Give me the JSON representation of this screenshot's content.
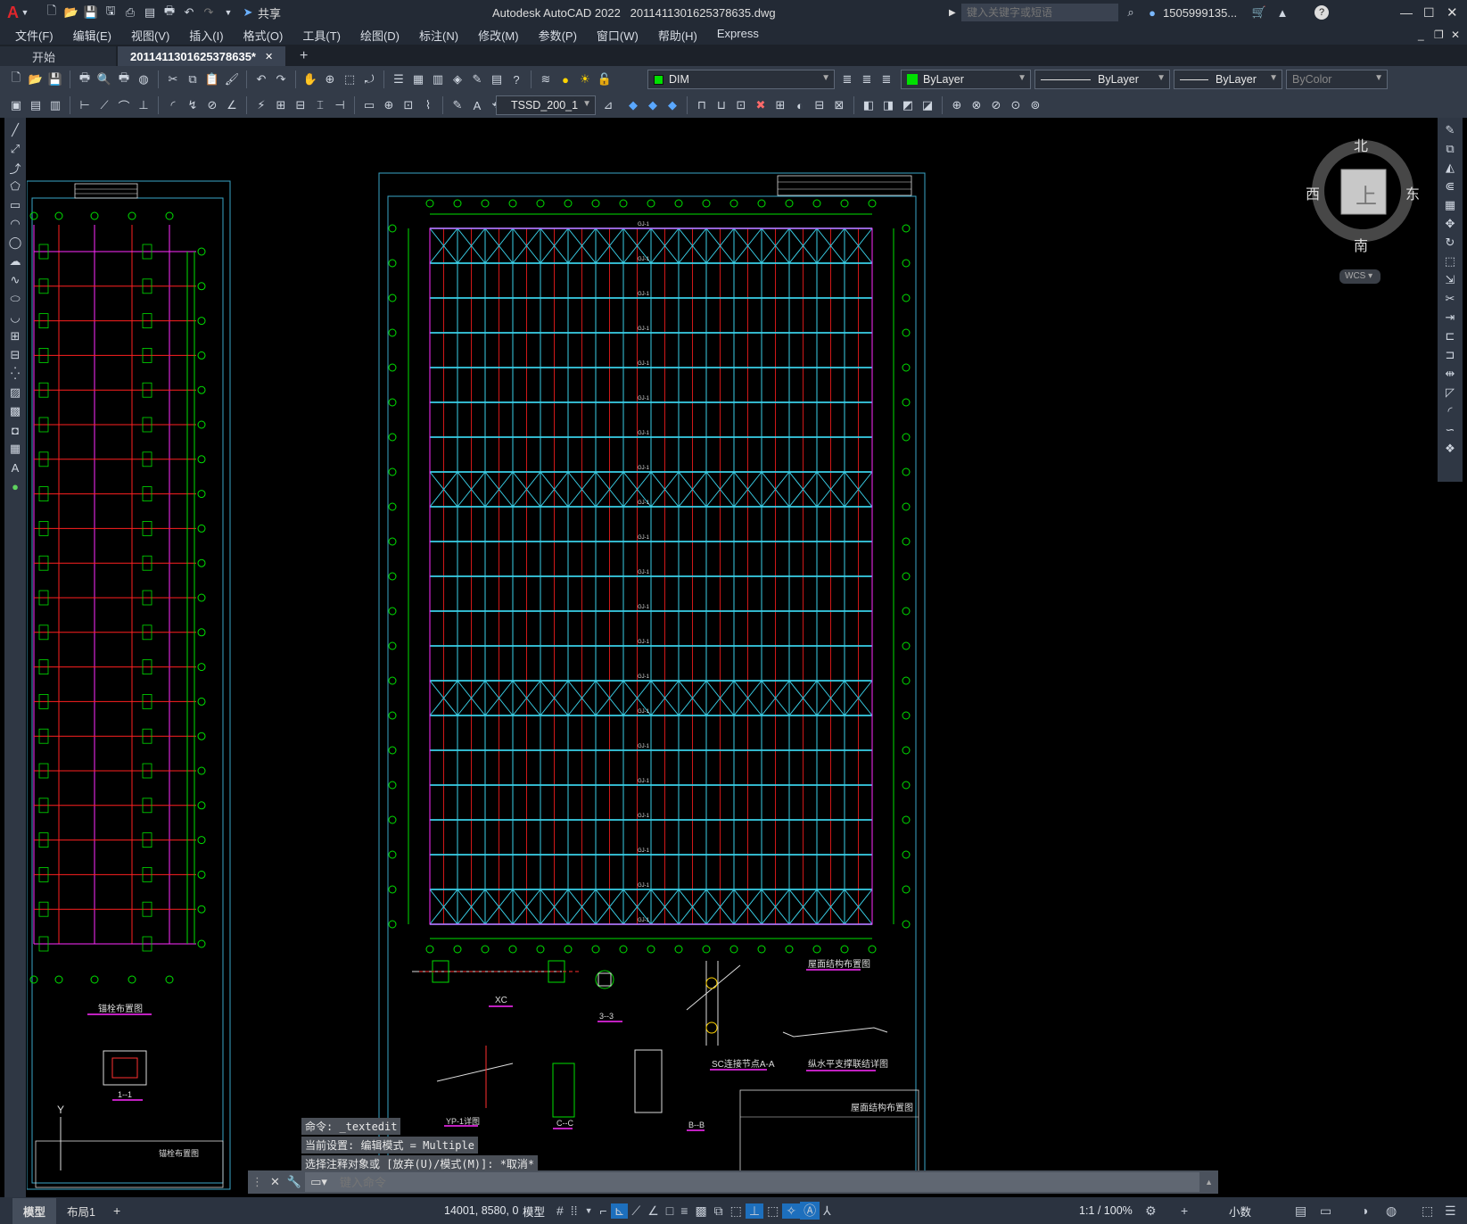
{
  "titlebar": {
    "logo": "A",
    "share": "共享",
    "app_title": "Autodesk AutoCAD 2022",
    "file_name": "20114113016253786 35.dwg",
    "search_placeholder": "键入关键字或短语",
    "user": "1505999135...",
    "icons": [
      "new-icon",
      "open-icon",
      "save-icon",
      "saveas-icon",
      "publish-icon",
      "print-icon",
      "undo-icon",
      "redo-icon",
      "share-icon",
      "search-icon",
      "user-icon",
      "cart-icon",
      "help-icon"
    ]
  },
  "menu": [
    "文件(F)",
    "编辑(E)",
    "视图(V)",
    "插入(I)",
    "格式(O)",
    "工具(T)",
    "绘图(D)",
    "标注(N)",
    "修改(M)",
    "参数(P)",
    "窗口(W)",
    "帮助(H)",
    "Express"
  ],
  "tabs": {
    "start": "开始",
    "drawing": "2011411301625378635*",
    "add": "+"
  },
  "toolbar": {
    "layer": "DIM",
    "color": "ByLayer",
    "linetype": "ByLayer",
    "lineweight": "ByLayer",
    "plotstyle": "ByColor",
    "dimstyle": "TSSD_200_1"
  },
  "viewcube": {
    "north": "北",
    "south": "南",
    "east": "东",
    "west": "西",
    "top": "上",
    "wcs": "WCS"
  },
  "drawing": {
    "left_title": "锚栓布置图",
    "left_section": "1--1",
    "right_title": "屋面结构布置图",
    "right_title_block": "屋面结构布置图",
    "detail_xc": "XC",
    "detail_33": "3--3",
    "detail_sc": "SC连接节点A-A",
    "detail_horizontal": "纵水平支撑联结详图",
    "detail_yp": "YP-1详图",
    "detail_cc": "C--C",
    "detail_bb": "B--B",
    "gj_label": "GJ-1"
  },
  "command": {
    "log": [
      "命令: _textedit",
      "当前设置: 编辑模式 = Multiple",
      "选择注释对象或 [放弃(U)/模式(M)]: *取消*"
    ],
    "placeholder": "键入命令"
  },
  "layout_tabs": {
    "model": "模型",
    "layout1": "布局1",
    "add": "+"
  },
  "status": {
    "coords": "14001, 8580, 0",
    "space": "模型",
    "scale": "1:1 / 100%",
    "units": "小数"
  }
}
